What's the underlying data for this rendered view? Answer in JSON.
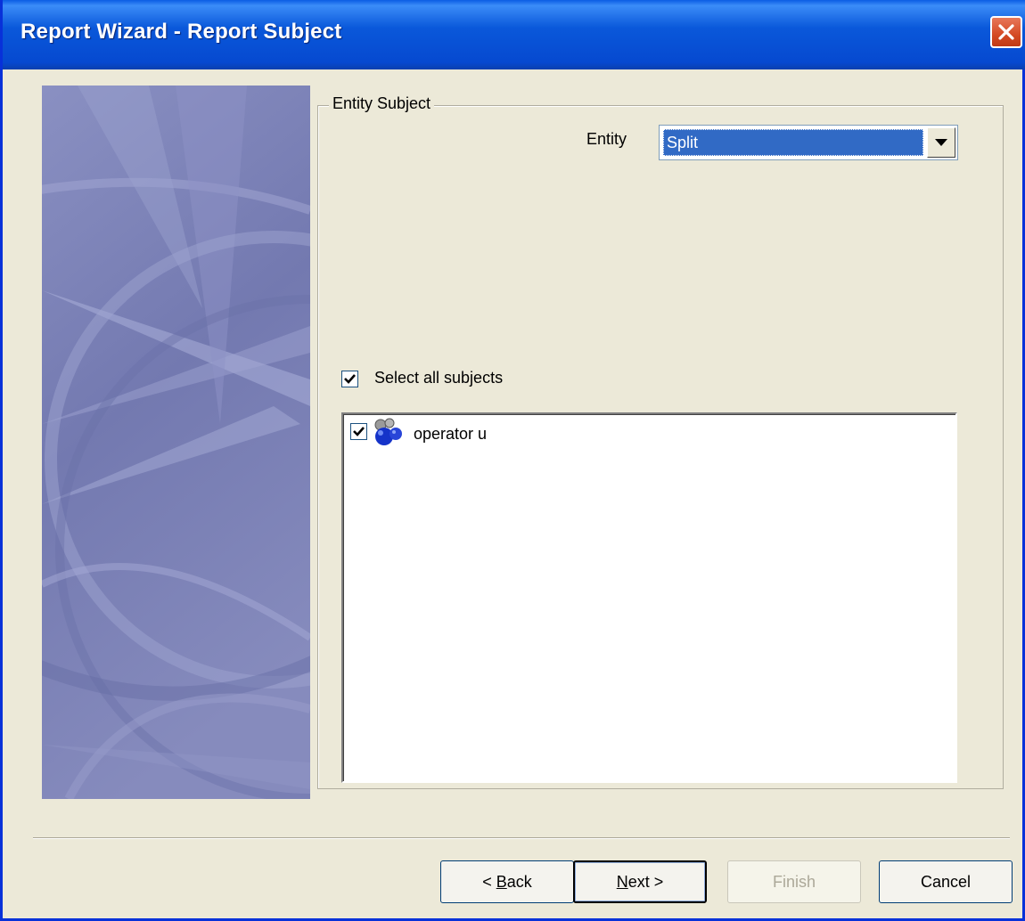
{
  "window": {
    "title": "Report Wizard - Report Subject"
  },
  "group": {
    "legend": "Entity Subject",
    "entity_label": "Entity",
    "entity_value": "Split"
  },
  "select_all": {
    "label": "Select all subjects",
    "checked": true
  },
  "subjects": [
    {
      "label": "operator u",
      "checked": true,
      "icon": "operator-group-icon"
    }
  ],
  "buttons": {
    "back": {
      "prefix": "< ",
      "mnemonic": "B",
      "rest": "ack"
    },
    "next": {
      "mnemonic": "N",
      "rest": "ext >"
    },
    "finish": "Finish",
    "cancel": "Cancel"
  },
  "colors": {
    "title_bar": "#0a58da",
    "selection": "#316ac5",
    "side_panel": "#7c82b6",
    "dialog_bg": "#ece9d8"
  }
}
